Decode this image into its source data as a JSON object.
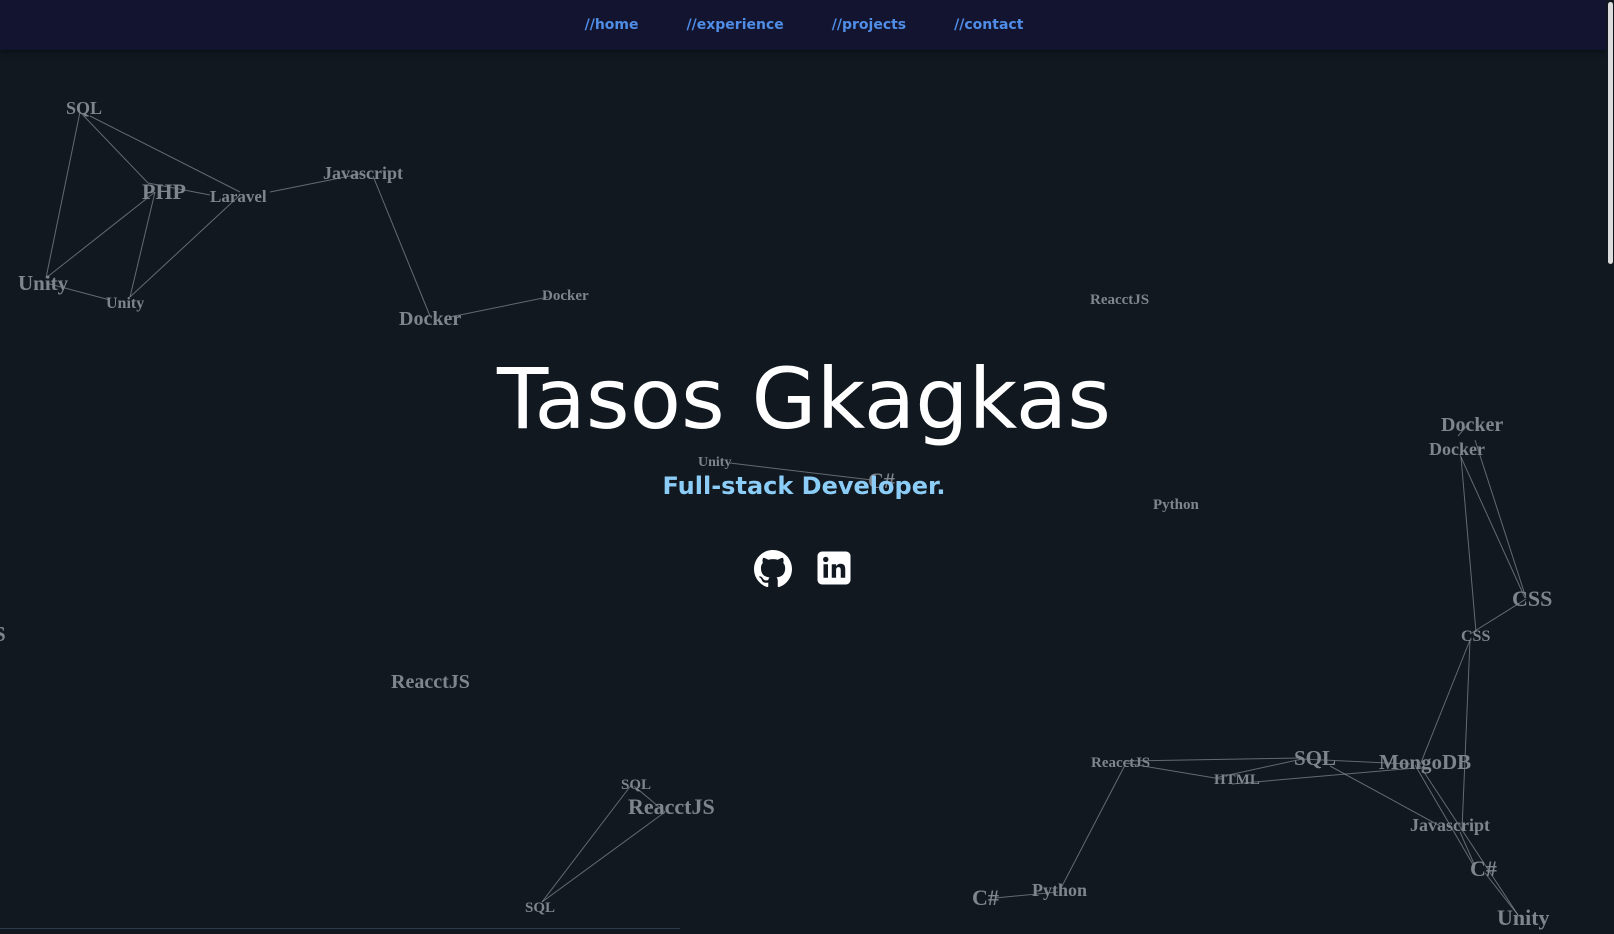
{
  "nav": {
    "items": [
      {
        "label": "//home"
      },
      {
        "label": "//experience"
      },
      {
        "label": "//projects"
      },
      {
        "label": "//contact"
      }
    ]
  },
  "hero": {
    "name": "Tasos Gkagkas",
    "subtitle": "Full-stack Developer."
  },
  "socials": [
    {
      "icon": "github-icon"
    },
    {
      "icon": "linkedin-icon"
    }
  ],
  "background_words": [
    "SQL",
    "PHP",
    "Laravel",
    "Javascript",
    "Unity",
    "Unity",
    "Docker",
    "Docker",
    "ReacctJS",
    "Unity",
    "C#",
    "Python",
    "Docker",
    "Docker",
    "CSS",
    "CSS",
    "S",
    "ReacctJS",
    "SQL",
    "ReacctJS",
    "SQL",
    "ReacctJS",
    "HTML",
    "SQL",
    "MongoDB",
    "Javascript",
    "C#",
    "Unity",
    "C#",
    "Python"
  ],
  "colors": {
    "background": "#111820",
    "nav_background": "#131530",
    "nav_link": "#4f8de6",
    "subtitle": "#8ccdf7",
    "word": "#7f858c"
  }
}
